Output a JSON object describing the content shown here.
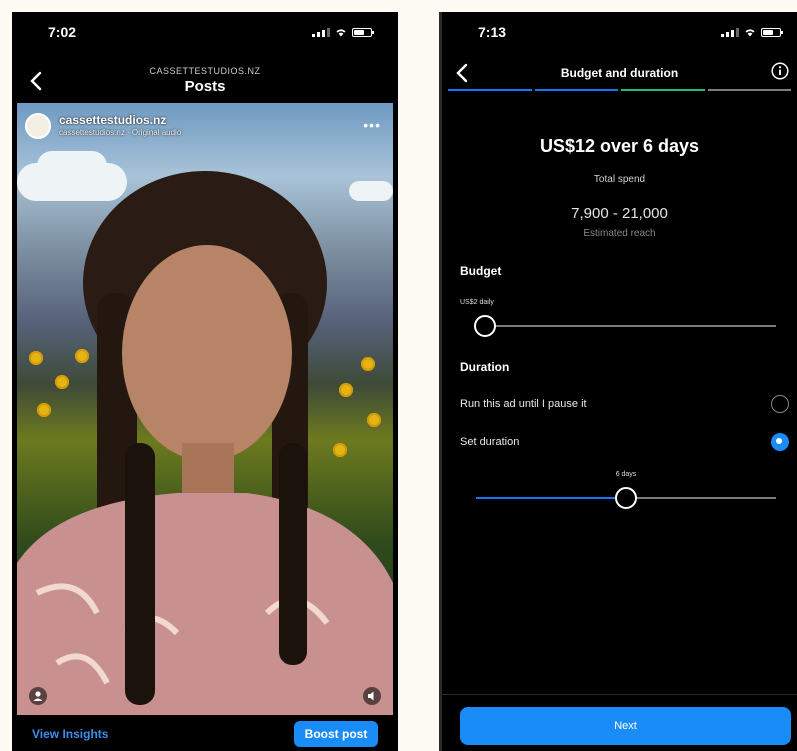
{
  "left_screen": {
    "status": {
      "time": "7:02"
    },
    "header": {
      "account": "CASSETTESTUDIOS.NZ",
      "title": "Posts"
    },
    "post": {
      "username": "cassettestudios.nz",
      "audio": "cassettestudios.nz · Original audio",
      "more_icon": "more-icon"
    },
    "footer": {
      "view_insights": "View Insights",
      "boost_post": "Boost post"
    }
  },
  "right_screen": {
    "status": {
      "time": "7:13"
    },
    "header": {
      "title": "Budget and duration",
      "info_icon": "info-icon"
    },
    "progress_segments": 4,
    "progress_active": 3,
    "summary": {
      "amount": "US$12 over 6 days",
      "amount_label": "Total spend",
      "reach": "7,900 - 21,000",
      "reach_label": "Estimated reach"
    },
    "budget": {
      "heading": "Budget",
      "value": "US$2 daily",
      "slider_level": 0.03
    },
    "duration": {
      "heading": "Duration",
      "option_until_pause": "Run this ad until I pause it",
      "option_set_duration": "Set duration",
      "selected": "set_duration",
      "value": "6 days",
      "slider_level": 0.5
    },
    "footer": {
      "next": "Next"
    },
    "colors": {
      "accent": "#1a8cf7",
      "progress_active": "#1877f2",
      "progress_done": "#1dbf73"
    }
  }
}
